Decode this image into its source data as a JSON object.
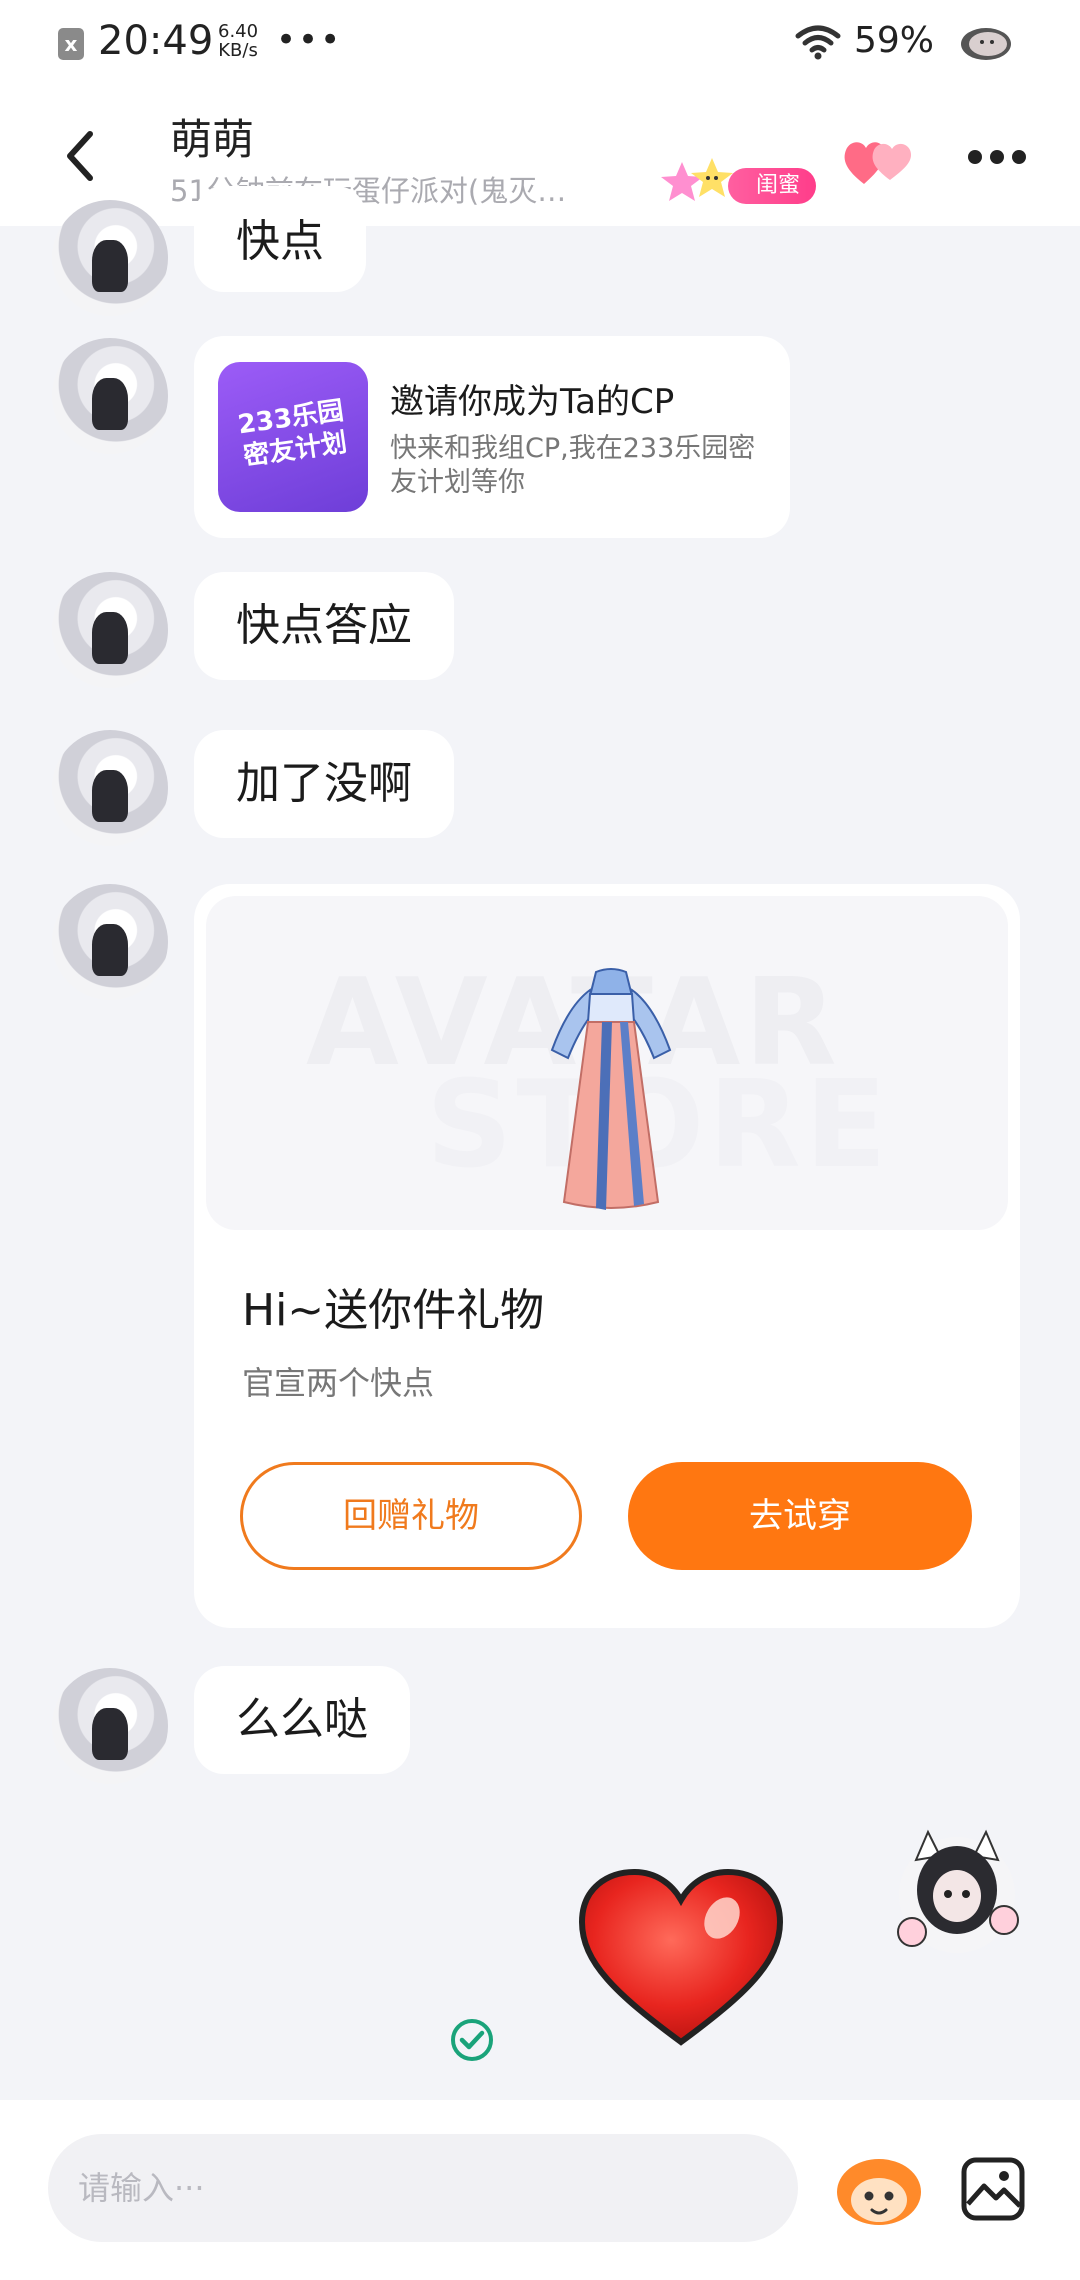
{
  "status_bar": {
    "time": "20:49",
    "speed_value": "6.40",
    "speed_unit": "KB/s",
    "more": "•••",
    "battery": "59%"
  },
  "header": {
    "name": "萌萌",
    "status": "51分钟前在玩蛋仔派对(鬼灭…",
    "badge": "闺蜜"
  },
  "messages": {
    "m1": "快点",
    "invite": {
      "icon_text_line1": "233乐园",
      "icon_text_line2": "密友计划",
      "title": "邀请你成为Ta的CP",
      "desc": "快来和我组CP,我在233乐园密友计划等你"
    },
    "m2": "快点答应",
    "m3": "加了没啊",
    "gift": {
      "watermark_line1": "AVATAR",
      "watermark_line2": "STORE",
      "title": "Hi~送你件礼物",
      "subtitle": "官宣两个快点",
      "return_gift_label": "回赠礼物",
      "try_on_label": "去试穿"
    },
    "m4": "么么哒"
  },
  "input": {
    "placeholder": "请输入···"
  },
  "colors": {
    "accent": "#ff7711",
    "badge": "#ff3d8a",
    "background": "#f3f4f8"
  }
}
